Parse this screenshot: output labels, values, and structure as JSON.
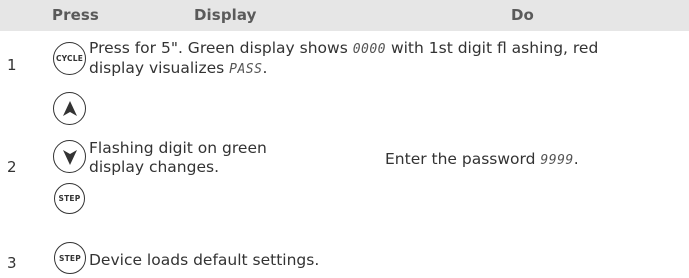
{
  "header": {
    "press": "Press",
    "display": "Display",
    "do": "Do"
  },
  "rows": [
    {
      "num": "1",
      "buttons": [
        {
          "label": "CYCLE"
        }
      ],
      "display_before": "Press for 5\". Green display shows ",
      "display_code1": "0000",
      "display_middle": " with 1st digit fl ashing, red",
      "display_line2_before": "display visualizes ",
      "display_code2": "PASS",
      "display_line2_after": "."
    },
    {
      "num": "2",
      "buttons": [
        {
          "icon": "arrow-up-icon"
        },
        {
          "icon": "arrow-down-icon"
        },
        {
          "label": "STEP"
        }
      ],
      "display_line1": "Flashing digit on green",
      "display_line2": "display changes.",
      "do_before": "Enter the password ",
      "do_code": "9999",
      "do_after": "."
    },
    {
      "num": "3",
      "buttons": [
        {
          "label": "STEP"
        }
      ],
      "display": "Device loads default settings."
    }
  ]
}
